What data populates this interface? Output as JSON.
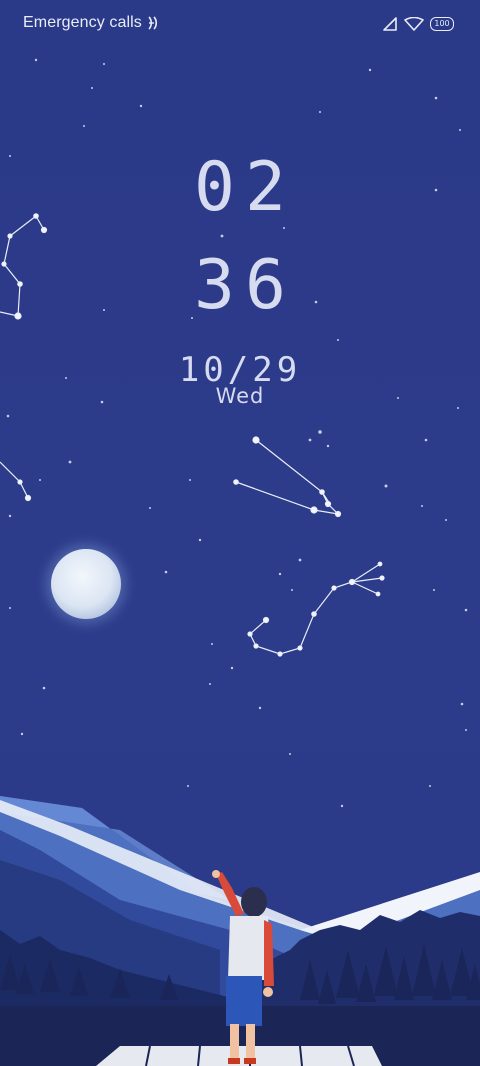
{
  "status_bar": {
    "carrier_text": "Emergency calls",
    "nfc_icon": "nfc-icon",
    "signal_icon": "signal-icon",
    "wifi_icon": "wifi-icon",
    "battery_level": "100"
  },
  "lockscreen": {
    "hour": "02",
    "minute": "36",
    "date": "10/29",
    "weekday": "Wed"
  },
  "wallpaper": {
    "theme": "night sky with constellations, moon, mountains and a boy pointing up",
    "colors": {
      "sky": "#2c3b8a",
      "moon": "#dfe8f4",
      "mountain_light": "#4f73c4",
      "mountain_dark": "#1f2c66",
      "shirt": "#e5e7ee",
      "sleeve": "#d94a3a",
      "shorts": "#2c57b8"
    }
  }
}
